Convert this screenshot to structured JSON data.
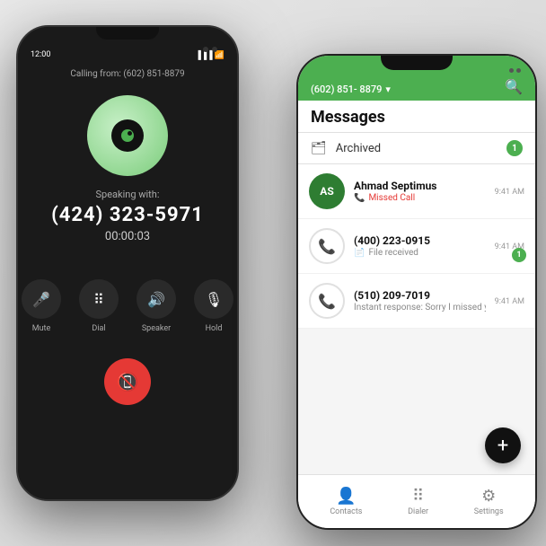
{
  "scene": {
    "background": "#e0e0e0"
  },
  "phone1": {
    "status_time": "12:00",
    "calling_label": "Calling from: (602) 851-8879",
    "speaking_label": "Speaking with:",
    "phone_number": "(424) 323-5971",
    "timer": "00:00:03",
    "controls": [
      {
        "id": "mute",
        "label": "Mute",
        "icon": "🎤"
      },
      {
        "id": "dial",
        "label": "Dial",
        "icon": "⠿"
      },
      {
        "id": "speaker",
        "label": "Speaker",
        "icon": "🔊"
      },
      {
        "id": "hold",
        "label": "Hold",
        "icon": "🎙"
      }
    ],
    "end_call_icon": "📵"
  },
  "phone2": {
    "top_number": "(602) 851- 8879",
    "title": "Messages",
    "search_icon": "🔍",
    "archived_label": "Archived",
    "archived_count": "1",
    "messages": [
      {
        "id": "msg1",
        "avatar_text": "AS",
        "name": "Ahmad Septimus",
        "preview_icon": "📞",
        "preview": "Missed Call",
        "time": "9:41 AM",
        "unread": false,
        "missed": true
      },
      {
        "id": "msg2",
        "avatar_text": "📞",
        "name": "(400) 223-0915",
        "preview_icon": "📄",
        "preview": "File received",
        "time": "9:41 AM",
        "unread": true,
        "unread_count": "1"
      },
      {
        "id": "msg3",
        "avatar_text": "📞",
        "name": "(510) 209-7019",
        "preview": "Instant response: Sorry I missed your call, I will...",
        "time": "9:41 AM",
        "unread": false
      }
    ],
    "nav": [
      {
        "id": "contacts",
        "icon": "👤",
        "label": "Contacts"
      },
      {
        "id": "dialer",
        "icon": "⠿",
        "label": "Dialer"
      },
      {
        "id": "settings",
        "icon": "⚙",
        "label": "Settings"
      }
    ],
    "fab_icon": "+"
  }
}
